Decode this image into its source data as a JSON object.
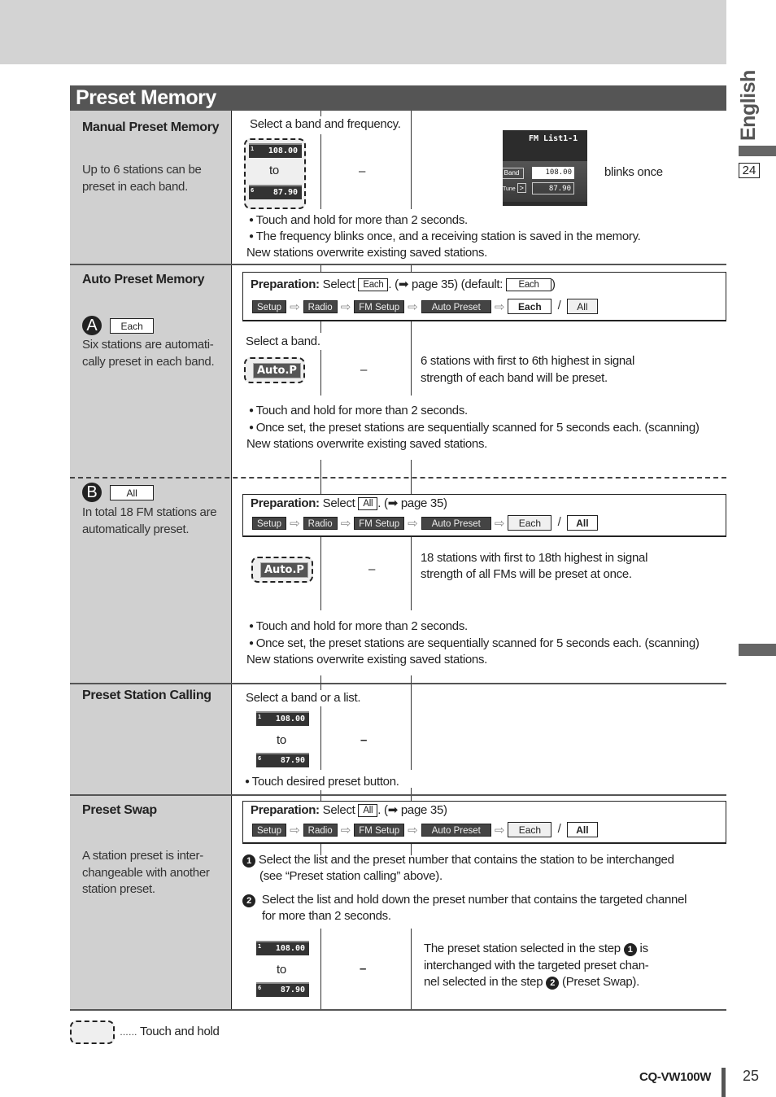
{
  "page": {
    "title": "Preset Memory",
    "side_language": "English",
    "side_page_ref": "24",
    "model": "CQ-VW100W",
    "page_number": "25"
  },
  "manual": {
    "heading": "Manual Preset Memory",
    "desc_lines": [
      "Up to 6 stations can be",
      "preset in each band."
    ],
    "instruction": "Select a band and frequency.",
    "freq_top": {
      "num": "1",
      "value": "108.00"
    },
    "freq_bottom": {
      "num": "6",
      "value": "87.90"
    },
    "to": "to",
    "dash": "–",
    "screen": {
      "title": "FM List1-1",
      "band": "Band",
      "tune": "Tune",
      "tune_arrow": ">",
      "freq1": "108.00",
      "freq2": "87.90"
    },
    "blinks": "blinks once",
    "notes": [
      "Touch and hold for more than 2 seconds.",
      "The frequency blinks once, and a receiving station is saved in the memory."
    ],
    "footer": "New stations overwrite existing saved stations."
  },
  "auto": {
    "heading": "Auto Preset Memory",
    "a": {
      "badge": "A",
      "chip": "Each",
      "desc_lines": [
        "Six stations are automati-",
        "cally preset in each band."
      ],
      "prep_label": "Preparation:",
      "prep_select": "Select",
      "prep_chip": "Each",
      "prep_page": ". (➡ page 35) (default:",
      "prep_default": "Each",
      "prep_close": ")",
      "path": [
        "Setup",
        "Radio",
        "FM Setup",
        "Auto Preset"
      ],
      "opt_each": "Each",
      "opt_sep": "/",
      "opt_all": "All",
      "instruction": "Select a band.",
      "button": "Auto.P",
      "dash": "–",
      "result_lines": [
        "6 stations with first to 6th highest in signal",
        "strength of each band will be preset."
      ],
      "notes": [
        "Touch and hold for more than 2 seconds.",
        "Once set, the preset stations are sequentially scanned for 5 seconds each. (scanning)"
      ],
      "footer": "New stations overwrite existing saved stations."
    },
    "b": {
      "badge": "B",
      "chip": "All",
      "desc_lines": [
        "In total 18 FM stations are",
        "automatically preset."
      ],
      "prep_label": "Preparation:",
      "prep_select": "Select",
      "prep_chip": "All",
      "prep_page": ". (➡ page 35)",
      "path": [
        "Setup",
        "Radio",
        "FM Setup",
        "Auto Preset"
      ],
      "opt_each": "Each",
      "opt_sep": "/",
      "opt_all": "All",
      "button": "Auto.P",
      "dash": "–",
      "result_lines": [
        "18 stations with first to 18th highest in signal",
        "strength of all FMs will be preset at once."
      ],
      "notes": [
        "Touch and hold for more than 2 seconds.",
        "Once set, the preset stations are sequentially scanned for 5 seconds each. (scanning)"
      ],
      "footer": "New stations overwrite existing saved stations."
    }
  },
  "calling": {
    "heading": "Preset Station Calling",
    "instruction": "Select a band or a list.",
    "freq_top": {
      "num": "1",
      "value": "108.00"
    },
    "freq_bottom": {
      "num": "6",
      "value": "87.90"
    },
    "to": "to",
    "dash": "–",
    "note": "Touch desired preset button."
  },
  "swap": {
    "heading": "Preset Swap",
    "desc_lines": [
      "A station preset is inter-",
      "changeable with another",
      "station preset."
    ],
    "prep_label": "Preparation:",
    "prep_select": "Select",
    "prep_chip": "All",
    "prep_page": ". (➡ page 35)",
    "path": [
      "Setup",
      "Radio",
      "FM Setup",
      "Auto Preset"
    ],
    "opt_each": "Each",
    "opt_sep": "/",
    "opt_all": "All",
    "step1_num": "1",
    "step1_lines": [
      "Select the list and the preset number that contains the station to be interchanged",
      "(see “Preset station calling” above)."
    ],
    "step2_num": "2",
    "step2_lines": [
      "Select the list and hold down the preset number that contains the targeted channel",
      "for more than 2 seconds."
    ],
    "freq_top": {
      "num": "1",
      "value": "108.00"
    },
    "freq_bottom": {
      "num": "6",
      "value": "87.90"
    },
    "to": "to",
    "dash": "–",
    "result_pre": "The preset station selected in the step",
    "result_post": "is",
    "result_line2": "interchanged with the targeted preset chan-",
    "result_line3_pre": "nel selected in the step",
    "result_line3_post": "(Preset Swap).",
    "result_num1": "1",
    "result_num2": "2"
  },
  "legend": {
    "dots": "……",
    "text": "Touch and hold"
  }
}
